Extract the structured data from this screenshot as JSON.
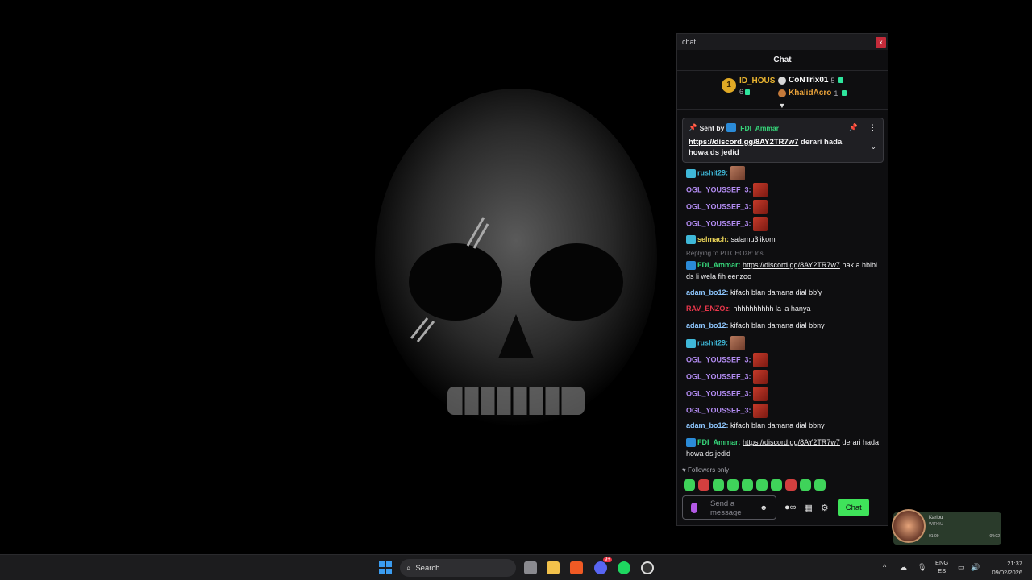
{
  "window": {
    "title": "chat",
    "close_label": "x"
  },
  "chat": {
    "header": "Chat",
    "leaderboard": {
      "first": {
        "rank": "1",
        "name": "ID_HOUS",
        "points": "6"
      },
      "second": {
        "name": "CoNTrix01",
        "points": "5"
      },
      "third": {
        "name": "KhalidAcro",
        "points": "1"
      }
    },
    "pinned": {
      "sent_by_label": "Sent by",
      "author": "FDI_Ammar",
      "link": "https://discord.gg/8AY2TR7w7",
      "text": "derari hada howa ds jedid"
    },
    "messages": [
      {
        "user": "rushit29:",
        "color": "#3fb8d8",
        "badge": true,
        "text": "",
        "emote": "face"
      },
      {
        "user": "OGL_YOUSSEF_3:",
        "color": "#b38cf3",
        "text": "",
        "emote": "red"
      },
      {
        "user": "OGL_YOUSSEF_3:",
        "color": "#b38cf3",
        "text": "",
        "emote": "red"
      },
      {
        "user": "OGL_YOUSSEF_3:",
        "color": "#b38cf3",
        "text": "",
        "emote": "red"
      },
      {
        "user": "selmach:",
        "color": "#e8d257",
        "badge": true,
        "text": "salamu3likom"
      },
      {
        "user": "FDI_Ammar:",
        "color": "#36d67a",
        "badge": true,
        "link": "https://discord.gg/8AY2TR7w7",
        "text": "hak a hbibi ds li wela fih eenzoo"
      },
      {
        "user": "adam_bo12:",
        "color": "#8ec7ff",
        "text": "kifach blan damana dial bb'y"
      },
      {
        "user": "RAV_ENZOz:",
        "color": "#e8374b",
        "text": "hhhhhhhhhh la la hanya"
      },
      {
        "user": "adam_bo12:",
        "color": "#8ec7ff",
        "text": "kifach blan damana dial bbny"
      },
      {
        "user": "rushit29:",
        "color": "#3fb8d8",
        "badge": true,
        "text": "",
        "emote": "face"
      },
      {
        "user": "OGL_YOUSSEF_3:",
        "color": "#b38cf3",
        "text": "",
        "emote": "red"
      },
      {
        "user": "OGL_YOUSSEF_3:",
        "color": "#b38cf3",
        "text": "",
        "emote": "red"
      },
      {
        "user": "OGL_YOUSSEF_3:",
        "color": "#b38cf3",
        "text": "",
        "emote": "red"
      },
      {
        "user": "OGL_YOUSSEF_3:",
        "color": "#b38cf3",
        "text": "",
        "emote": "red"
      },
      {
        "user": "adam_bo12:",
        "color": "#8ec7ff",
        "text": "kifach blan damana dial bbny"
      },
      {
        "user": "FDI_Ammar:",
        "color": "#36d67a",
        "badge": true,
        "link": "https://discord.gg/8AY2TR7w7",
        "text": "derari hada howa ds jedid"
      }
    ],
    "reply_note": "Replying to PITCHOz8: lds",
    "followers_only": "Followers only",
    "input_placeholder": "Send a message",
    "send_label": "Chat"
  },
  "media": {
    "title": "Karibu",
    "artist": "WITH\\U",
    "elapsed": "01:09",
    "duration": "04:02"
  },
  "taskbar": {
    "search_label": "Search",
    "lang_top": "ENG",
    "lang_bottom": "ES",
    "time": "21:37",
    "date": "09/02/2026",
    "discord_badge": "9+"
  }
}
